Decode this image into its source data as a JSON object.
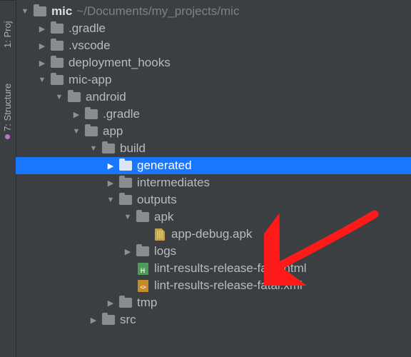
{
  "side_tabs": {
    "project": "1: Proj",
    "structure": "7: Structure"
  },
  "root": {
    "name": "mic",
    "path": "~/Documents/my_projects/mic"
  },
  "nodes": {
    "gradle": ".gradle",
    "vscode": ".vscode",
    "deployment_hooks": "deployment_hooks",
    "mic_app": "mic-app",
    "android": "android",
    "android_gradle": ".gradle",
    "app": "app",
    "build": "build",
    "generated": "generated",
    "intermediates": "intermediates",
    "outputs": "outputs",
    "apk": "apk",
    "app_debug": "app-debug.apk",
    "logs": "logs",
    "lint_html": "lint-results-release-fatal.html",
    "lint_xml": "lint-results-release-fatal.xml",
    "tmp": "tmp",
    "src": "src"
  }
}
